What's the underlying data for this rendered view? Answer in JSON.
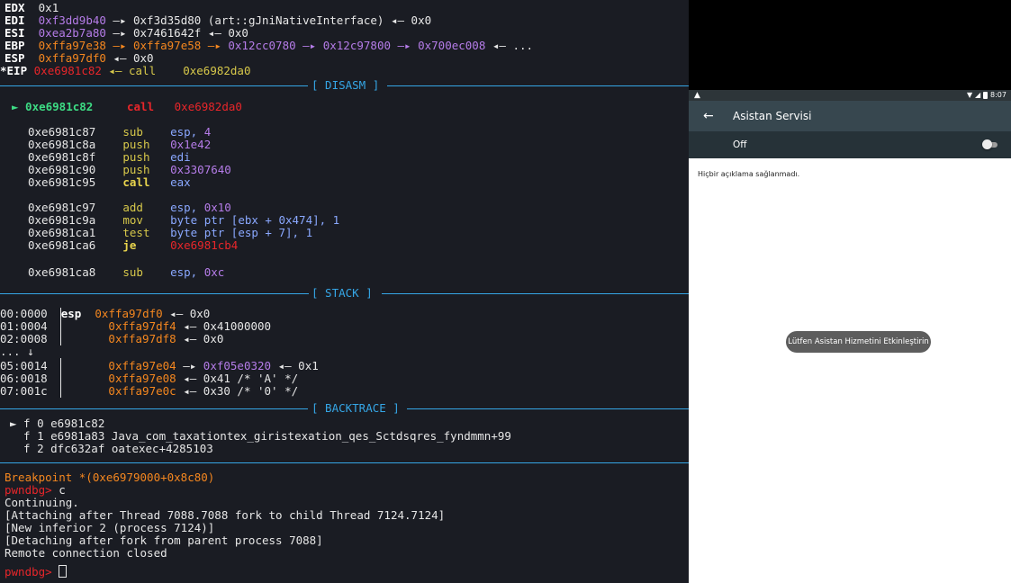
{
  "registers": [
    {
      "name": "EDX",
      "value": "0x1",
      "rest": ""
    },
    {
      "name": "EDI",
      "value": "0xf3dd9b40",
      "rest": " —▸ 0xf3d35d80 (art::gJniNativeInterface) ◂— 0x0"
    },
    {
      "name": "ESI",
      "value": "0xea2b7a80",
      "rest": " —▸ 0x7461642f ◂— 0x0"
    },
    {
      "name": "EBP",
      "value": "0xffa97e38",
      "chain": " —▸ 0xffa97e58 —▸ ",
      "chain2": "0x12cc0780 —▸ 0x12c97800 —▸ 0x700ec008",
      "rest": " ◂— ..."
    },
    {
      "name": "ESP",
      "value": "0xffa97df0",
      "rest": " ◂— 0x0"
    },
    {
      "name": "*EIP",
      "value": "0xe6981c82",
      "rest": " ◂— call    0xe6982da0"
    }
  ],
  "sections": {
    "disasm": "[ DISASM ]",
    "stack": "[ STACK ]",
    "backtrace": "[ BACKTRACE ]"
  },
  "disasm": {
    "current": {
      "addr": "► 0xe6981c82",
      "mnem": "call",
      "op": "0xe6982da0"
    },
    "lines": [
      {
        "addr": "0xe6981c87",
        "mnem": "sub",
        "op": "esp, ",
        "imm": "4"
      },
      {
        "addr": "0xe6981c8a",
        "mnem": "push",
        "op": "",
        "imm": "0x1e42"
      },
      {
        "addr": "0xe6981c8f",
        "mnem": "push",
        "op": "edi",
        "imm": ""
      },
      {
        "addr": "0xe6981c90",
        "mnem": "push",
        "op": "",
        "imm": "0x3307640"
      },
      {
        "addr": "0xe6981c95",
        "mnem": "call",
        "op": "eax",
        "imm": ""
      },
      {
        "addr": "0xe6981c97",
        "mnem": "add",
        "op": "esp, ",
        "imm": "0x10"
      },
      {
        "addr": "0xe6981c9a",
        "mnem": "mov",
        "op": "byte ptr [ebx + 0x474], 1",
        "imm": ""
      },
      {
        "addr": "0xe6981ca1",
        "mnem": "test",
        "op": "byte ptr [esp + 7], 1",
        "imm": ""
      },
      {
        "addr": "0xe6981ca6",
        "mnem": "je",
        "op": "0xe6981cb4",
        "imm": ""
      },
      {
        "addr": "0xe6981ca8",
        "mnem": "sub",
        "op": "esp, ",
        "imm": "0xc"
      }
    ]
  },
  "stack": [
    {
      "idx": "00:0000",
      "reg": "esp",
      "addr": "0xffa97df0",
      "rest": " ◂— 0x0"
    },
    {
      "idx": "01:0004",
      "reg": "",
      "addr": "0xffa97df4",
      "rest": " ◂— 0x41000000"
    },
    {
      "idx": "02:0008",
      "reg": "",
      "addr": "0xffa97df8",
      "rest": " ◂— 0x0"
    },
    {
      "idx": "... ↓",
      "reg": "",
      "addr": "",
      "rest": ""
    },
    {
      "idx": "05:0014",
      "reg": "",
      "addr": "0xffa97e04",
      "rest2": " —▸ ",
      "purple": "0xf05e0320",
      "rest": " ◂— 0x1"
    },
    {
      "idx": "06:0018",
      "reg": "",
      "addr": "0xffa97e08",
      "rest": " ◂— 0x41 /* 'A' */"
    },
    {
      "idx": "07:001c",
      "reg": "",
      "addr": "0xffa97e0c",
      "rest": " ◂— 0x30 /* '0' */"
    }
  ],
  "backtrace": [
    "► f 0 e6981c82",
    "  f 1 e6981a83 Java_com_taxationtex_giristexation_qes_Sctdsqres_fyndmmn+99",
    "  f 2 dfc632af oatexec+4285103"
  ],
  "console": {
    "breakpoint": "Breakpoint *(0xe6979000+0x8c80)",
    "prompt": "pwndbg> ",
    "command": "c",
    "lines": [
      "Continuing.",
      "[Attaching after Thread 7088.7088 fork to child Thread 7124.7124]",
      "[New inferior 2 (process 7124)]",
      "[Detaching after fork from parent process 7088]",
      "Remote connection closed"
    ]
  },
  "android": {
    "status_time": "8:07",
    "title": "Asistan Servisi",
    "toggle_label": "Off",
    "toggle_on": false,
    "description": "Hiçbir açıklama sağlanmadı.",
    "toast": "Lütfen Asistan Hizmetini Etkinleştirin"
  }
}
